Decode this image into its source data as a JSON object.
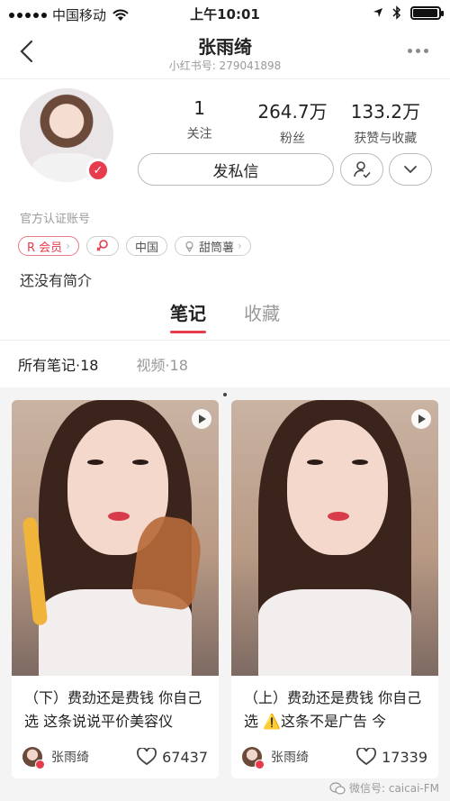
{
  "status_bar": {
    "carrier": "中国移动",
    "time": "上午10:01",
    "battery_level": 0.95
  },
  "nav": {
    "title": "张雨绮",
    "subtitle": "小红书号: 279041898"
  },
  "profile": {
    "stats": [
      {
        "value": "1",
        "label": "关注"
      },
      {
        "value": "264.7万",
        "label": "粉丝"
      },
      {
        "value": "133.2万",
        "label": "获赞与收藏"
      }
    ],
    "message_button": "发私信",
    "official_label": "官方认证账号",
    "tags": [
      {
        "label": "R 会员"
      },
      {
        "label": ""
      },
      {
        "label": "中国"
      },
      {
        "label": "甜筒薯"
      }
    ],
    "intro": "还没有简介"
  },
  "tabs": [
    {
      "label": "笔记",
      "active": true
    },
    {
      "label": "收藏",
      "active": false
    }
  ],
  "filters": [
    {
      "label": "所有笔记·18",
      "active": true
    },
    {
      "label": "视频·18",
      "active": false
    }
  ],
  "notes": [
    {
      "title": "（下）费劲还是费钱 你自己选 这条说说平价美容仪",
      "author": "张雨绮",
      "likes": "67437"
    },
    {
      "title": "（上）费劲还是费钱 你自己选 ⚠️这条不是广告 今",
      "author": "张雨绮",
      "likes": "17339"
    }
  ],
  "watermark": "微信号: caicai-FM",
  "colors": {
    "accent": "#e63c4d",
    "muted": "#9a9a9a",
    "feed_bg": "#f4f4f4"
  },
  "icons": [
    "signal-dots-icon",
    "wifi-icon",
    "location-icon",
    "bluetooth-icon",
    "battery-icon",
    "back-icon",
    "more-icon",
    "verified-icon",
    "follow-person-icon",
    "chevron-down-icon",
    "female-icon",
    "cone-icon",
    "play-icon",
    "heart-icon",
    "wechat-icon"
  ]
}
